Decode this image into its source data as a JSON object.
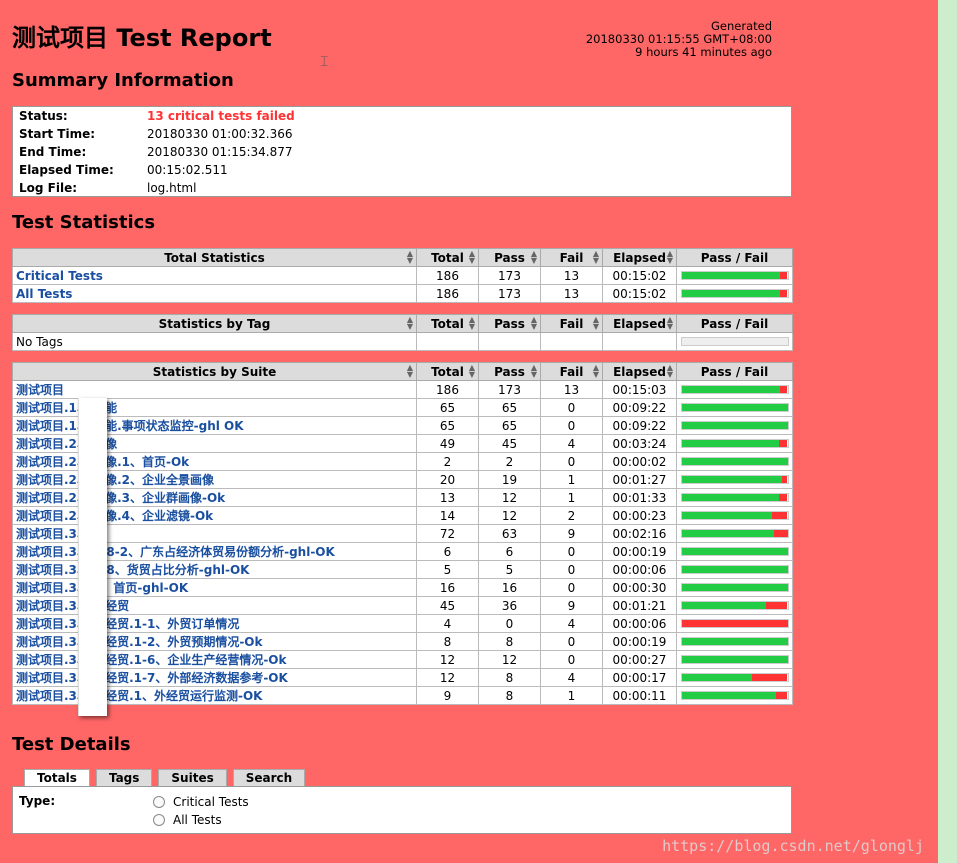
{
  "header": {
    "title": "测试项目 Test Report",
    "generated_label": "Generated",
    "generated_time": "20180330 01:15:55 GMT+08:00",
    "generated_ago": "9 hours 41 minutes ago"
  },
  "summary": {
    "heading": "Summary Information",
    "rows": [
      {
        "label": "Status:",
        "value": "13 critical tests failed"
      },
      {
        "label": "Start Time:",
        "value": "20180330 01:00:32.366"
      },
      {
        "label": "End Time:",
        "value": "20180330 01:15:34.877"
      },
      {
        "label": "Elapsed Time:",
        "value": "00:15:02.511"
      },
      {
        "label": "Log File:",
        "value": "log.html"
      }
    ]
  },
  "statistics": {
    "heading": "Test Statistics",
    "columns": [
      "Total",
      "Pass",
      "Fail",
      "Elapsed",
      "Pass / Fail"
    ],
    "total": {
      "header": "Total Statistics",
      "rows": [
        {
          "name": "Critical Tests",
          "total": "186",
          "pass": "173",
          "fail": "13",
          "elapsed": "00:15:02",
          "pass_ratio": 0.93
        },
        {
          "name": "All Tests",
          "total": "186",
          "pass": "173",
          "fail": "13",
          "elapsed": "00:15:02",
          "pass_ratio": 0.93
        }
      ]
    },
    "tag": {
      "header": "Statistics by Tag",
      "empty": "No Tags"
    },
    "suite": {
      "header": "Statistics by Suite",
      "rows": [
        {
          "name": "测试项目",
          "total": "186",
          "pass": "173",
          "fail": "13",
          "elapsed": "00:15:03",
          "pass_ratio": 0.93
        },
        {
          "name": "测试项目.1、     效能",
          "total": "65",
          "pass": "65",
          "fail": "0",
          "elapsed": "00:09:22",
          "pass_ratio": 1.0
        },
        {
          "name": "测试项目.1、     效能.事项状态监控-ghl OK",
          "total": "65",
          "pass": "65",
          "fail": "0",
          "elapsed": "00:09:22",
          "pass_ratio": 1.0
        },
        {
          "name": "测试项目.2、     画像",
          "total": "49",
          "pass": "45",
          "fail": "4",
          "elapsed": "00:03:24",
          "pass_ratio": 0.918
        },
        {
          "name": "测试项目.2、     画像.1、首页-Ok",
          "total": "2",
          "pass": "2",
          "fail": "0",
          "elapsed": "00:00:02",
          "pass_ratio": 1.0
        },
        {
          "name": "测试项目.2、     画像.2、企业全景画像",
          "total": "20",
          "pass": "19",
          "fail": "1",
          "elapsed": "00:01:27",
          "pass_ratio": 0.95
        },
        {
          "name": "测试项目.2、     画像.3、企业群画像-Ok",
          "total": "13",
          "pass": "12",
          "fail": "1",
          "elapsed": "00:01:33",
          "pass_ratio": 0.923
        },
        {
          "name": "测试项目.2、     画像.4、企业滤镜-Ok",
          "total": "14",
          "pass": "12",
          "fail": "2",
          "elapsed": "00:00:23",
          "pass_ratio": 0.857
        },
        {
          "name": "测试项目.3、",
          "total": "72",
          "pass": "63",
          "fail": "9",
          "elapsed": "00:02:16",
          "pass_ratio": 0.875
        },
        {
          "name": "测试项目.3、     1-8-2、广东占经济体贸易份额分析-ghl-OK",
          "total": "6",
          "pass": "6",
          "fail": "0",
          "elapsed": "00:00:19",
          "pass_ratio": 1.0
        },
        {
          "name": "测试项目.3、     1-8、货贸占比分析-ghl-OK",
          "total": "5",
          "pass": "5",
          "fail": "0",
          "elapsed": "00:00:06",
          "pass_ratio": 1.0
        },
        {
          "name": "测试项目.3、     1、首页-ghl-OK",
          "total": "16",
          "pass": "16",
          "fail": "0",
          "elapsed": "00:00:30",
          "pass_ratio": 1.0
        },
        {
          "name": "测试项目.3、     外经贸",
          "total": "45",
          "pass": "36",
          "fail": "9",
          "elapsed": "00:01:21",
          "pass_ratio": 0.8
        },
        {
          "name": "测试项目.3、     外经贸.1-1、外贸订单情况",
          "total": "4",
          "pass": "0",
          "fail": "4",
          "elapsed": "00:00:06",
          "pass_ratio": 0.0
        },
        {
          "name": "测试项目.3、     外经贸.1-2、外贸预期情况-Ok",
          "total": "8",
          "pass": "8",
          "fail": "0",
          "elapsed": "00:00:19",
          "pass_ratio": 1.0
        },
        {
          "name": "测试项目.3、     外经贸.1-6、企业生产经营情况-Ok",
          "total": "12",
          "pass": "12",
          "fail": "0",
          "elapsed": "00:00:27",
          "pass_ratio": 1.0
        },
        {
          "name": "测试项目.3、     外经贸.1-7、外部经济数据参考-OK",
          "total": "12",
          "pass": "8",
          "fail": "4",
          "elapsed": "00:00:17",
          "pass_ratio": 0.667
        },
        {
          "name": "测试项目.3、     外经贸.1、外经贸运行监测-OK",
          "total": "9",
          "pass": "8",
          "fail": "1",
          "elapsed": "00:00:11",
          "pass_ratio": 0.889
        }
      ]
    }
  },
  "details": {
    "heading": "Test Details",
    "tabs": [
      "Totals",
      "Tags",
      "Suites",
      "Search"
    ],
    "type_label": "Type:",
    "options": [
      "Critical Tests",
      "All Tests"
    ]
  },
  "watermark": "https://blog.csdn.net/glonglj",
  "colors": {
    "background": "#ff6666",
    "pass": "#22cc44",
    "fail": "#ff3333",
    "link": "#1a4fa0"
  }
}
